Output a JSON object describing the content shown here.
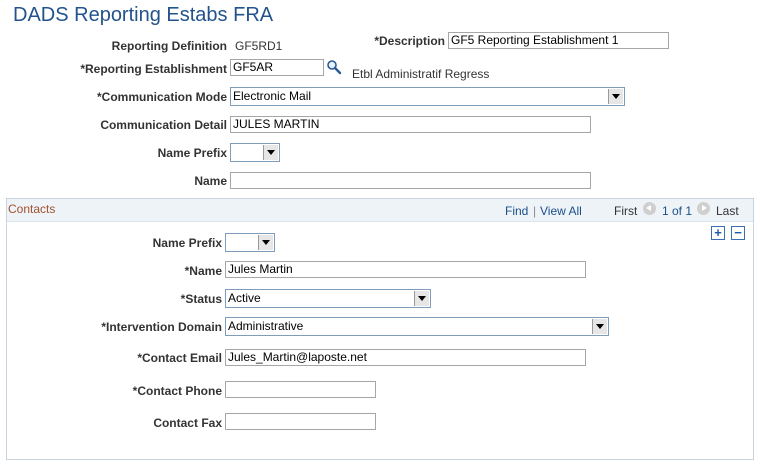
{
  "page": {
    "title": "DADS Reporting Estabs FRA"
  },
  "form": {
    "reporting_definition_label": "Reporting Definition",
    "reporting_definition_value": "GF5RD1",
    "description_label": "*Description",
    "description_value": "GF5 Reporting Establishment 1",
    "reporting_establishment_label": "*Reporting Establishment",
    "reporting_establishment_value": "GF5AR",
    "reporting_establishment_desc": "Etbl Administratif Regress",
    "communication_mode_label": "*Communication Mode",
    "communication_mode_value": "Electronic Mail",
    "communication_detail_label": "Communication Detail",
    "communication_detail_value": "JULES MARTIN",
    "name_prefix_label": "Name Prefix",
    "name_prefix_value": "",
    "name_label": "Name",
    "name_value": ""
  },
  "contacts": {
    "title": "Contacts",
    "find_label": "Find",
    "separator": "|",
    "view_all_label": "View All",
    "first_label": "First",
    "page_indicator": "1 of 1",
    "last_label": "Last",
    "add_icon_glyph": "+",
    "remove_icon_glyph": "−",
    "name_prefix_label": "Name Prefix",
    "name_prefix_value": "",
    "name_label": "*Name",
    "name_value": "Jules Martin",
    "status_label": "*Status",
    "status_value": "Active",
    "intervention_domain_label": "*Intervention Domain",
    "intervention_domain_value": "Administrative",
    "contact_email_label": "*Contact Email",
    "contact_email_value": "Jules_Martin@laposte.net",
    "contact_phone_label": "*Contact Phone",
    "contact_phone_value": "",
    "contact_fax_label": "Contact Fax",
    "contact_fax_value": ""
  }
}
